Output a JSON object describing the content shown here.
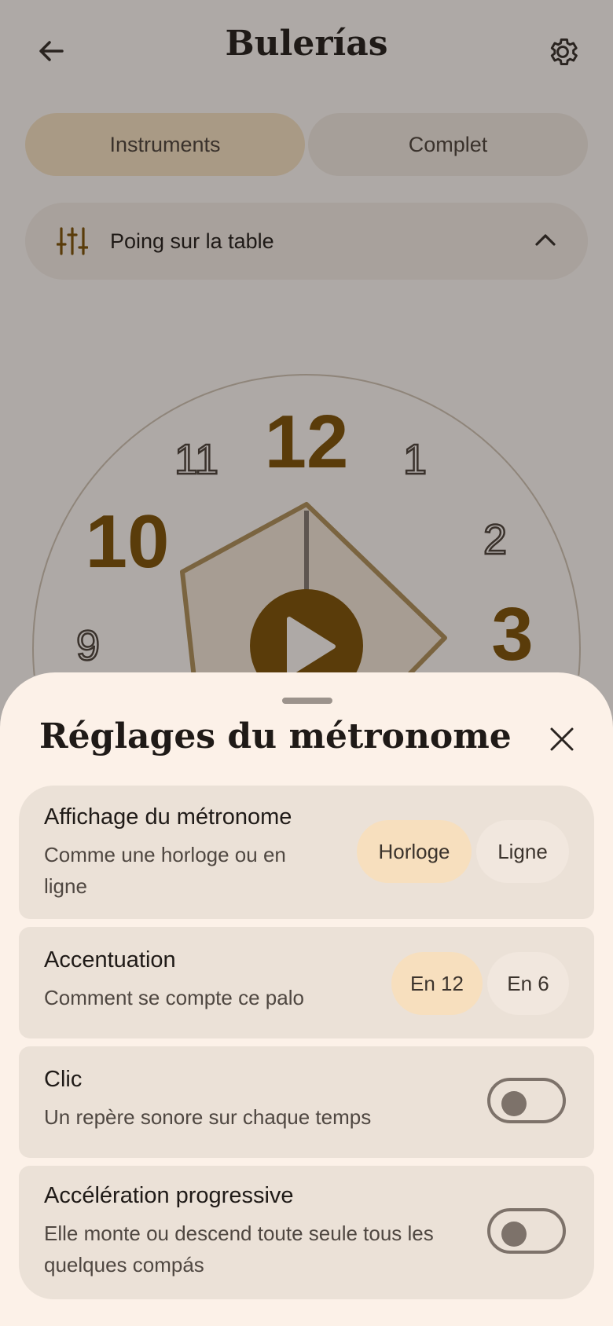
{
  "header": {
    "title": "Bulerías",
    "back_icon": "arrow-left-icon",
    "settings_icon": "gear-icon"
  },
  "tabs": [
    {
      "label": "Instruments",
      "active": true
    },
    {
      "label": "Complet",
      "active": false
    }
  ],
  "instrument_selector": {
    "label": "Poing sur la table",
    "icon": "sliders-icon",
    "expanded_icon": "chevron-up-icon"
  },
  "clock": {
    "numbers": [
      "12",
      "1",
      "2",
      "3",
      "9",
      "10",
      "11"
    ],
    "accented": [
      "12",
      "3",
      "10"
    ],
    "play_icon": "play-icon",
    "accent_color": "#5a3c0a"
  },
  "sheet": {
    "title": "Réglages du métronome",
    "close_icon": "close-icon",
    "settings": [
      {
        "title": "Affichage du métronome",
        "description": "Comme une horloge ou en ligne",
        "options": [
          "Horloge",
          "Ligne"
        ],
        "selected": "Horloge"
      },
      {
        "title": "Accentuation",
        "description": "Comment se compte ce palo",
        "options": [
          "En 12",
          "En 6"
        ],
        "selected": "En 12"
      },
      {
        "title": "Clic",
        "description": "Un repère sonore sur chaque temps",
        "toggle_on": false
      },
      {
        "title": "Accélération progressive",
        "description": "Elle monte ou descend toute seule tous les quelques compás",
        "toggle_on": false
      }
    ]
  },
  "colors": {
    "selected_segment": "#f7dfbe",
    "sheet_background": "#fcf1e8",
    "card_background": "#ebe1d7"
  }
}
